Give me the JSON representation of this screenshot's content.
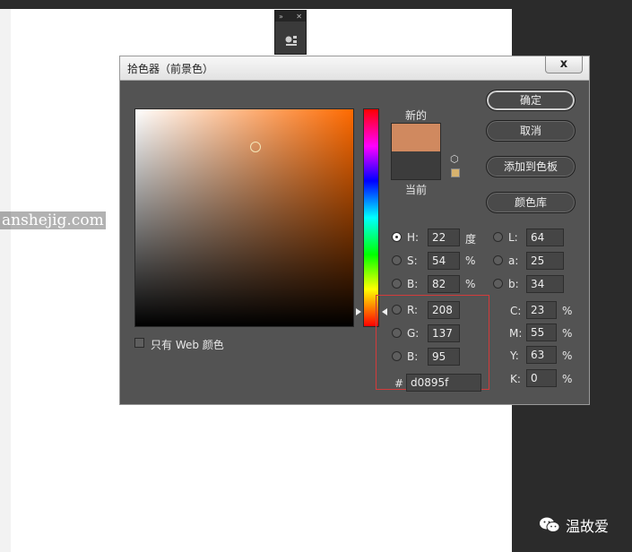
{
  "dialog": {
    "title": "拾色器（前景色）",
    "close_label": "x",
    "labels": {
      "new": "新的",
      "current": "当前"
    },
    "buttons": {
      "ok": "确定",
      "cancel": "取消",
      "add_swatch": "添加到色板",
      "libraries": "颜色库"
    },
    "colors": {
      "new": "#d0895f",
      "current": "#3c3c3c",
      "field_hue": "#ff6a00",
      "small_swatch": "#d8b36e"
    },
    "hsb": {
      "h": {
        "label": "H:",
        "value": "22",
        "unit": "度"
      },
      "s": {
        "label": "S:",
        "value": "54",
        "unit": "%"
      },
      "b": {
        "label": "B:",
        "value": "82",
        "unit": "%"
      }
    },
    "lab": {
      "l": {
        "label": "L:",
        "value": "64"
      },
      "a": {
        "label": "a:",
        "value": "25"
      },
      "b": {
        "label": "b:",
        "value": "34"
      }
    },
    "rgb": {
      "r": {
        "label": "R:",
        "value": "208"
      },
      "g": {
        "label": "G:",
        "value": "137"
      },
      "b": {
        "label": "B:",
        "value": "95"
      }
    },
    "cmyk": {
      "c": {
        "label": "C:",
        "value": "23",
        "unit": "%"
      },
      "m": {
        "label": "M:",
        "value": "55",
        "unit": "%"
      },
      "y": {
        "label": "Y:",
        "value": "63",
        "unit": "%"
      },
      "k": {
        "label": "K:",
        "value": "0",
        "unit": "%"
      }
    },
    "hex": {
      "label": "#",
      "value": "d0895f"
    },
    "web_only": "只有 Web 颜色"
  },
  "watermark": "anshejig.com",
  "wechat": {
    "account": "温故爱"
  }
}
